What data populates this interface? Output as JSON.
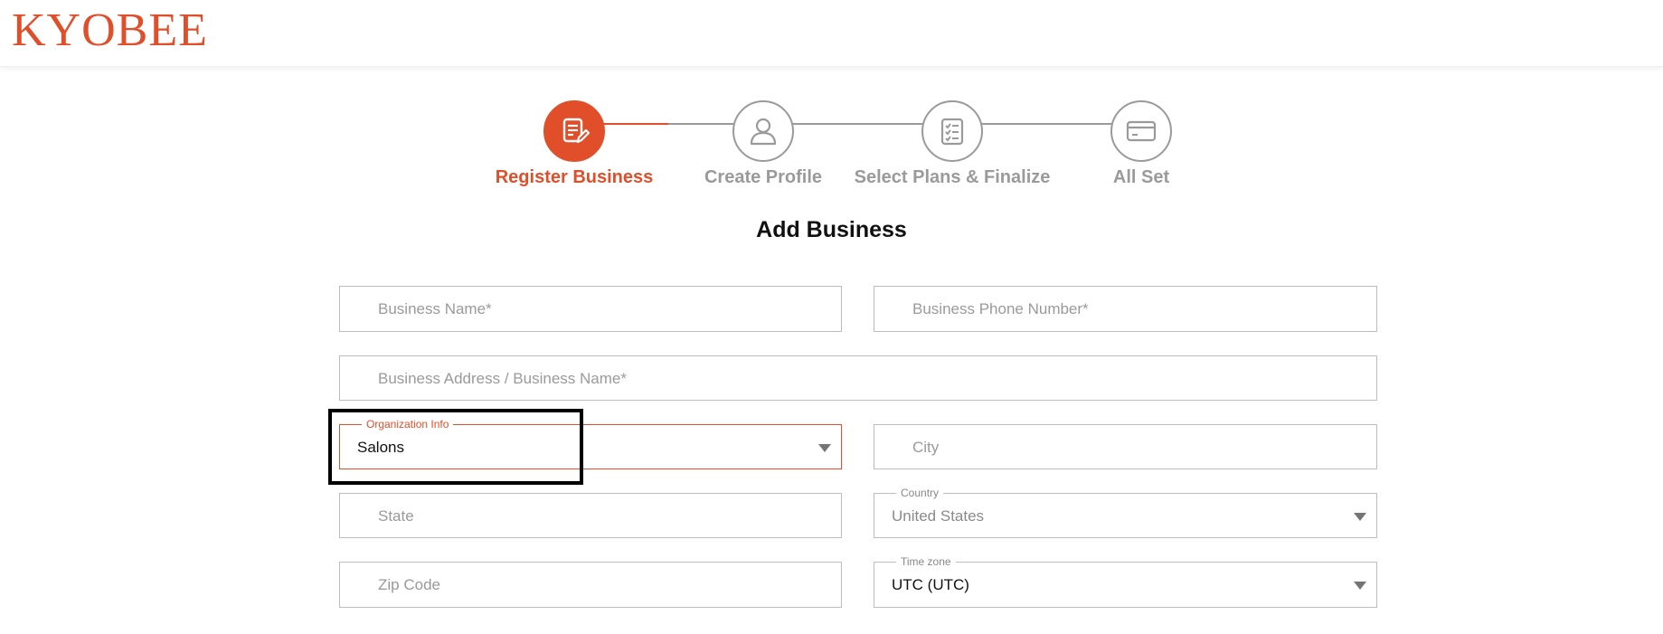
{
  "header": {
    "logo": "KYOBEE"
  },
  "stepper": {
    "steps": [
      {
        "label": "Register Business",
        "icon": "edit-document-icon",
        "state": "active"
      },
      {
        "label": "Create Profile",
        "icon": "person-icon",
        "state": "pending"
      },
      {
        "label": "Select Plans & Finalize",
        "icon": "checklist-icon",
        "state": "pending"
      },
      {
        "label": "All Set",
        "icon": "credit-card-icon",
        "state": "pending"
      }
    ]
  },
  "form": {
    "title": "Add Business",
    "business_name": {
      "placeholder": "Business Name*"
    },
    "business_phone": {
      "placeholder": "Business Phone Number*"
    },
    "business_address": {
      "placeholder": "Business Address / Business Name*"
    },
    "organization_info": {
      "label": "Organization Info",
      "value": "Salons"
    },
    "city": {
      "placeholder": "City"
    },
    "state": {
      "placeholder": "State"
    },
    "country": {
      "label": "Country",
      "value": "United States"
    },
    "zip_code": {
      "placeholder": "Zip Code"
    },
    "time_zone": {
      "label": "Time zone",
      "value": "UTC (UTC)"
    }
  },
  "colors": {
    "accent": "#e04e2a",
    "inactive": "#9a9a9a",
    "border": "#bdbdbd"
  }
}
